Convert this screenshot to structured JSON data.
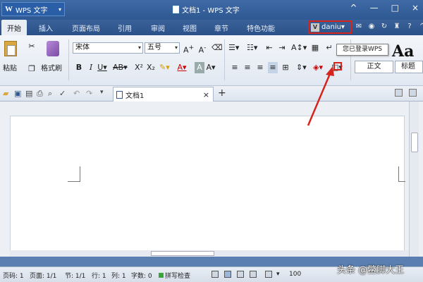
{
  "titlebar": {
    "app_name": "WPS 文字",
    "doc_title": "文档1 - WPS 文字",
    "controls": [
      "^",
      "—",
      "□",
      "×"
    ]
  },
  "menu": {
    "tabs": [
      "开始",
      "插入",
      "页面布局",
      "引用",
      "审阅",
      "视图",
      "章节",
      "特色功能"
    ],
    "active_tab": "开始",
    "user_badge": "V",
    "user_name": "daniu▾",
    "top_icons": [
      "mail-icon",
      "shield-icon",
      "refresh-icon",
      "shirt-icon",
      "help-icon",
      "ribbon-toggle-icon"
    ]
  },
  "ribbon": {
    "paste_label": "粘贴",
    "format_painter_label": "格式刷",
    "font_name": "宋体",
    "font_size": "五号",
    "style_normal": "正文",
    "style_heading": "标题",
    "style_preview": "Aa",
    "tooltip": "您已登录WPS"
  },
  "doc_tab": {
    "title": "文档1",
    "close": "×",
    "new_tab": "+"
  },
  "status": {
    "page": "页码: 1",
    "pages": "页面: 1/1",
    "section": "节: 1/1",
    "row": "行: 1",
    "col": "列: 1",
    "words": "字数: 0",
    "spellcheck": "拼写检查",
    "zoom": "100"
  },
  "watermark": "头条 @鳖脚大王",
  "colors": {
    "titlebar": "#2e5891",
    "highlight_red": "#d6241c"
  }
}
